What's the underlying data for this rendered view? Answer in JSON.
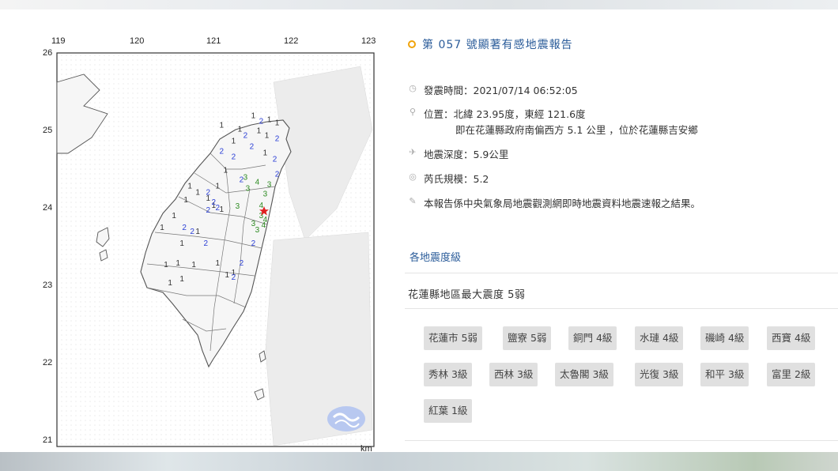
{
  "map": {
    "lon_labels": [
      "119",
      "120",
      "121",
      "122",
      "123"
    ],
    "lat_labels": [
      "26",
      "25",
      "24",
      "23",
      "22",
      "21"
    ],
    "unit_label": "km",
    "epicenter_marker": "red-star",
    "intensity_colors": {
      "1": "#333333",
      "2": "#2b3fd6",
      "3": "#2e8b22",
      "4": "#2e8b22"
    },
    "stations": [
      {
        "v": "1",
        "lon": 121.45,
        "lat": 25.17
      },
      {
        "v": "2",
        "lon": 121.55,
        "lat": 25.1
      },
      {
        "v": "1",
        "lon": 121.65,
        "lat": 25.12
      },
      {
        "v": "1",
        "lon": 121.75,
        "lat": 25.08
      },
      {
        "v": "1",
        "lon": 121.05,
        "lat": 25.05
      },
      {
        "v": "1",
        "lon": 121.28,
        "lat": 25.0
      },
      {
        "v": "1",
        "lon": 121.2,
        "lat": 24.85
      },
      {
        "v": "2",
        "lon": 121.35,
        "lat": 24.92
      },
      {
        "v": "1",
        "lon": 121.52,
        "lat": 24.98
      },
      {
        "v": "1",
        "lon": 121.62,
        "lat": 24.92
      },
      {
        "v": "2",
        "lon": 121.75,
        "lat": 24.88
      },
      {
        "v": "2",
        "lon": 121.43,
        "lat": 24.78
      },
      {
        "v": "1",
        "lon": 121.6,
        "lat": 24.7
      },
      {
        "v": "2",
        "lon": 121.72,
        "lat": 24.62
      },
      {
        "v": "2",
        "lon": 121.05,
        "lat": 24.72
      },
      {
        "v": "2",
        "lon": 121.2,
        "lat": 24.65
      },
      {
        "v": "1",
        "lon": 121.1,
        "lat": 24.48
      },
      {
        "v": "1",
        "lon": 121.0,
        "lat": 24.28
      },
      {
        "v": "2",
        "lon": 121.3,
        "lat": 24.36
      },
      {
        "v": "3",
        "lon": 121.35,
        "lat": 24.39
      },
      {
        "v": "4",
        "lon": 121.5,
        "lat": 24.33
      },
      {
        "v": "3",
        "lon": 121.65,
        "lat": 24.3
      },
      {
        "v": "3",
        "lon": 121.6,
        "lat": 24.18
      },
      {
        "v": "2",
        "lon": 121.75,
        "lat": 24.43
      },
      {
        "v": "3",
        "lon": 121.38,
        "lat": 24.25
      },
      {
        "v": "3",
        "lon": 121.25,
        "lat": 24.02
      },
      {
        "v": "4",
        "lon": 121.55,
        "lat": 24.03
      },
      {
        "v": "3",
        "lon": 121.55,
        "lat": 23.9
      },
      {
        "v": "4",
        "lon": 121.6,
        "lat": 23.85
      },
      {
        "v": "3",
        "lon": 121.45,
        "lat": 23.8
      },
      {
        "v": "4",
        "lon": 121.58,
        "lat": 23.78
      },
      {
        "v": "3",
        "lon": 121.5,
        "lat": 23.72
      },
      {
        "v": "1",
        "lon": 120.65,
        "lat": 24.28
      },
      {
        "v": "1",
        "lon": 120.75,
        "lat": 24.2
      },
      {
        "v": "2",
        "lon": 120.88,
        "lat": 24.2
      },
      {
        "v": "1",
        "lon": 120.88,
        "lat": 24.12
      },
      {
        "v": "1",
        "lon": 120.95,
        "lat": 24.03
      },
      {
        "v": "2",
        "lon": 120.95,
        "lat": 24.07
      },
      {
        "v": "1",
        "lon": 120.6,
        "lat": 24.1
      },
      {
        "v": "2",
        "lon": 120.88,
        "lat": 23.97
      },
      {
        "v": "1",
        "lon": 120.45,
        "lat": 23.9
      },
      {
        "v": "1",
        "lon": 121.05,
        "lat": 23.98
      },
      {
        "v": "2",
        "lon": 121.0,
        "lat": 24.0
      },
      {
        "v": "1",
        "lon": 120.3,
        "lat": 23.75
      },
      {
        "v": "2",
        "lon": 120.58,
        "lat": 23.75
      },
      {
        "v": "2",
        "lon": 120.68,
        "lat": 23.7
      },
      {
        "v": "1",
        "lon": 120.75,
        "lat": 23.7
      },
      {
        "v": "1",
        "lon": 120.55,
        "lat": 23.55
      },
      {
        "v": "2",
        "lon": 120.85,
        "lat": 23.55
      },
      {
        "v": "2",
        "lon": 121.45,
        "lat": 23.55
      },
      {
        "v": "1",
        "lon": 120.35,
        "lat": 23.28
      },
      {
        "v": "1",
        "lon": 120.5,
        "lat": 23.3
      },
      {
        "v": "1",
        "lon": 120.7,
        "lat": 23.28
      },
      {
        "v": "1",
        "lon": 121.0,
        "lat": 23.3
      },
      {
        "v": "2",
        "lon": 121.3,
        "lat": 23.3
      },
      {
        "v": "1",
        "lon": 121.2,
        "lat": 23.18
      },
      {
        "v": "1",
        "lon": 121.12,
        "lat": 23.15
      },
      {
        "v": "1",
        "lon": 120.55,
        "lat": 23.1
      },
      {
        "v": "1",
        "lon": 120.4,
        "lat": 23.05
      },
      {
        "v": "2",
        "lon": 121.2,
        "lat": 23.12
      }
    ]
  },
  "report": {
    "title_prefix": "第 057 號顯著有感地震報告",
    "time_label": "發震時間：2021/07/14 06:52:05",
    "location_label": "位置：北緯 23.95度，東經 121.6度",
    "location_detail": "即在花蓮縣政府南偏西方 5.1 公里 ，位於花蓮縣吉安鄉",
    "depth_label": "地震深度：5.9公里",
    "magnitude_label": "芮氏規模：5.2",
    "source_note": "本報告係中央氣象局地震觀測網即時地震資料地震速報之結果。",
    "section_link": "各地震度級",
    "max_intensity": "花蓮縣地區最大震度 5弱",
    "icons": [
      "clock-icon",
      "location-pin-icon",
      "depth-icon",
      "magnitude-icon",
      "info-icon"
    ]
  },
  "chips": [
    "花蓮市 5弱",
    "鹽寮 5弱",
    "銅門 4級",
    "水璉 4級",
    "磯崎 4級",
    "西寶 4級",
    "秀林 3級",
    "西林 3級",
    "太魯閣 3級",
    "光復 3級",
    "和平 3級",
    "富里 2級",
    "紅葉 1級"
  ],
  "colors": {
    "accent": "#2b5c9a",
    "ring": "#f0a30a",
    "chip_bg": "#e0e0e0",
    "epicenter": "#e02020"
  }
}
